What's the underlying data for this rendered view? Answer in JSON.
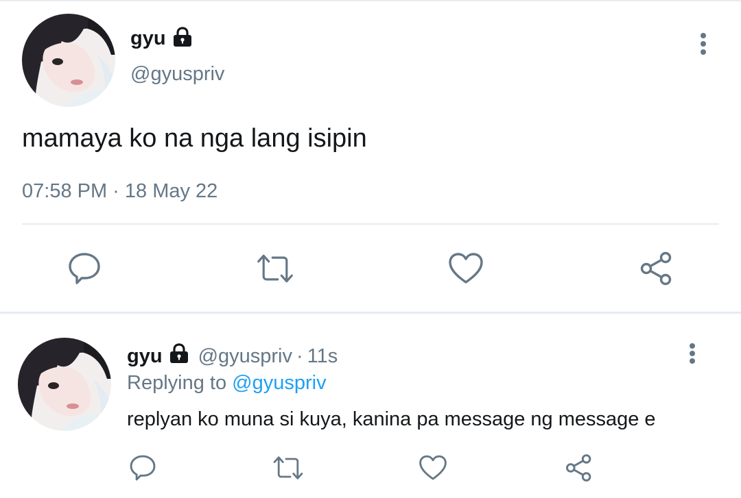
{
  "main_tweet": {
    "author_name": "gyu",
    "handle": "@gyuspriv",
    "text": "mamaya ko na nga lang isipin",
    "timestamp": "07:58 PM · 18 May 22",
    "avatar_icon": "profile-photo",
    "protected_icon": "lock-icon",
    "actions": [
      "reply-icon",
      "retweet-icon",
      "like-icon",
      "share-icon"
    ]
  },
  "reply_tweet": {
    "author_name": "gyu",
    "handle": "@gyuspriv",
    "separator": "·",
    "time_ago": "11s",
    "replying_label": "Replying to",
    "replying_to": "@gyuspriv",
    "text": "replyan ko muna si kuya, kanina pa message ng message e",
    "actions": [
      "reply-icon",
      "retweet-icon",
      "like-icon",
      "share-icon"
    ]
  },
  "colors": {
    "text_primary": "#14171a",
    "text_secondary": "#657786",
    "link": "#1da1f2",
    "divider": "#e6ecf0",
    "icon": "#657786"
  }
}
